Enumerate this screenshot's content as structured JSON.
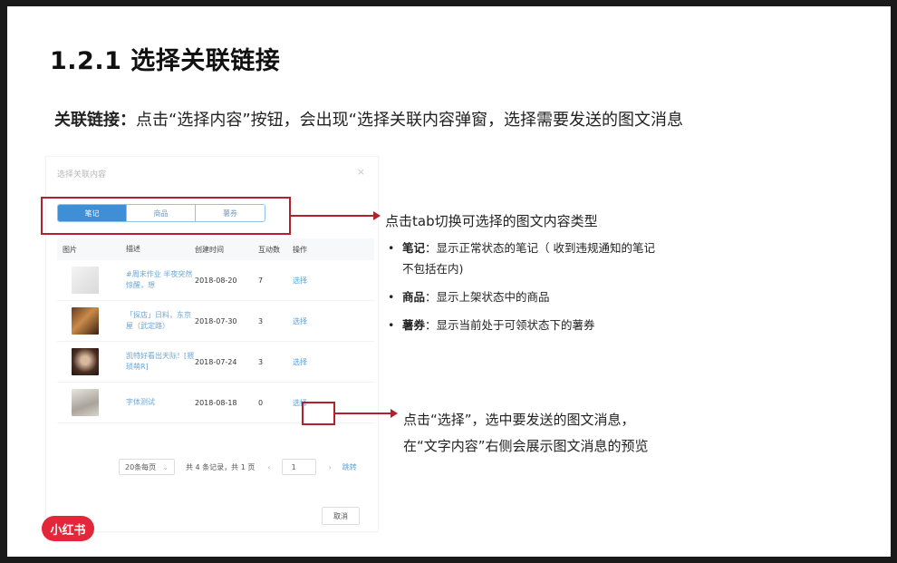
{
  "slide": {
    "title": "1.2.1 选择关联链接",
    "subtitle_bold": "关联链接：",
    "subtitle_rest": "点击“选择内容”按钮，会出现“选择关联内容弹窗，选择需要发送的图文消息"
  },
  "modal": {
    "title": "选择关联内容",
    "close": "×",
    "tabs": [
      {
        "label": "笔记",
        "active": true
      },
      {
        "label": "商品",
        "active": false
      },
      {
        "label": "薯券",
        "active": false
      }
    ],
    "columns": [
      "图片",
      "描述",
      "创建时间",
      "互动数",
      "操作"
    ],
    "rows": [
      {
        "desc": "#周末作业 半夜突然惊醒，想",
        "date": "2018-08-20",
        "count": "7",
        "op": "选择"
      },
      {
        "desc": "「探店」日料，东京屋（武定路）",
        "date": "2018-07-30",
        "count": "3",
        "op": "选择"
      },
      {
        "desc": "凯特好看出天际！[猥琐萌R]",
        "date": "2018-07-24",
        "count": "3",
        "op": "选择"
      },
      {
        "desc": "字体测试",
        "date": "2018-08-18",
        "count": "0",
        "op": "选择"
      }
    ],
    "pager": {
      "page_size": "20条每页",
      "info": "共 4 条记录，共 1 页",
      "prev": "‹",
      "page": "1",
      "next": "›",
      "jump": "跳转"
    },
    "cancel": "取消"
  },
  "annotations": {
    "tabs_note": "点击tab切换可选择的图文内容类型",
    "bullets": [
      {
        "term": "笔记",
        "text": "：显示正常状态的笔记（ 收到违规通知的笔记不包括在内)"
      },
      {
        "term": "商品",
        "text": "：显示上架状态中的商品"
      },
      {
        "term": "薯券",
        "text": "：显示当前处于可领状态下的薯券"
      }
    ],
    "select_note": "点击“选择”，选中要发送的图文消息，在“文字内容”右侧会展示图文消息的预览"
  },
  "logo": "小红书",
  "colors": {
    "highlight": "#b3212c",
    "tab_active": "#3f8fd6",
    "link": "#5a9fd6",
    "logo": "#e3263a"
  }
}
